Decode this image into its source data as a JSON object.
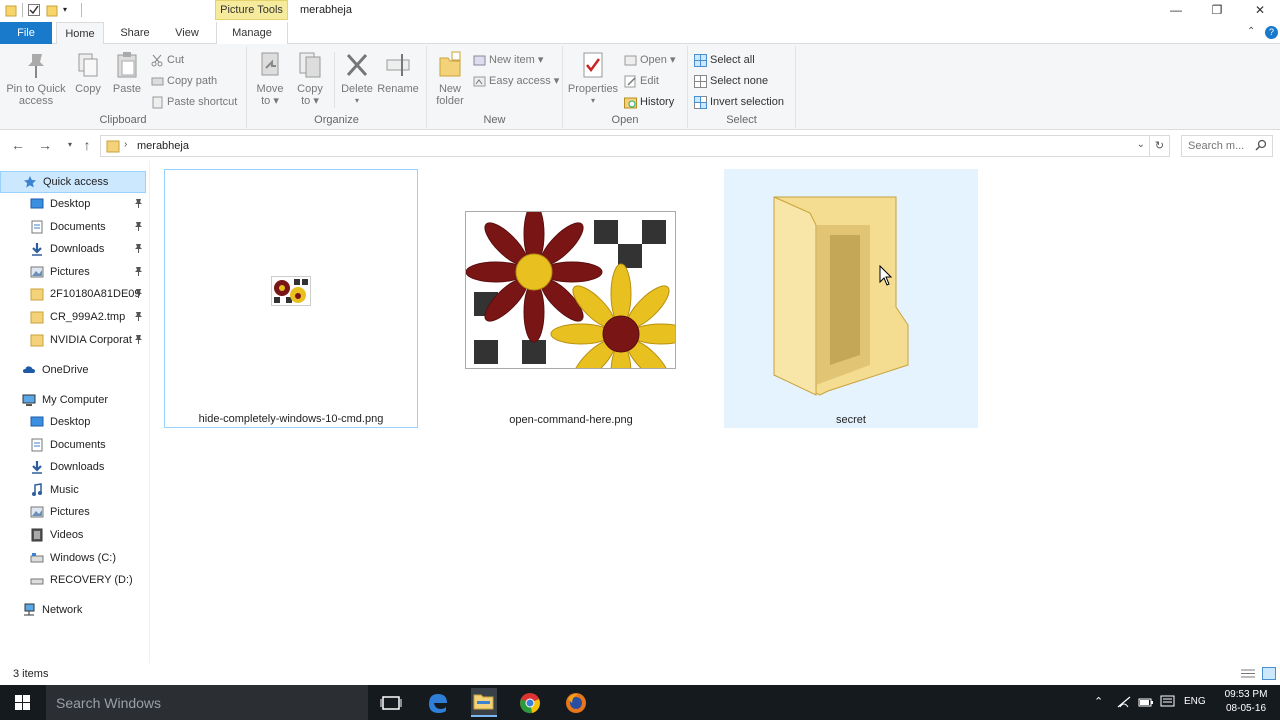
{
  "window": {
    "title": "merabheja",
    "context_tab": "Picture Tools",
    "controls": {
      "minimize": "—",
      "restore": "❐",
      "close": "✕"
    }
  },
  "tabs": {
    "file": "File",
    "home": "Home",
    "share": "Share",
    "view": "View",
    "manage": "Manage"
  },
  "ribbon": {
    "clipboard": {
      "label": "Clipboard",
      "pin_line1": "Pin to Quick",
      "pin_line2": "access",
      "copy": "Copy",
      "paste": "Paste",
      "cut": "Cut",
      "copy_path": "Copy path",
      "paste_shortcut": "Paste shortcut"
    },
    "organize": {
      "label": "Organize",
      "move_line1": "Move",
      "move_line2": "to ▾",
      "copyto_line1": "Copy",
      "copyto_line2": "to ▾",
      "delete": "Delete",
      "rename": "Rename"
    },
    "new": {
      "label": "New",
      "new_folder_line1": "New",
      "new_folder_line2": "folder",
      "new_item": "New item ▾",
      "easy_access": "Easy access ▾"
    },
    "open": {
      "label": "Open",
      "properties": "Properties",
      "open": "Open ▾",
      "edit": "Edit",
      "history": "History"
    },
    "select": {
      "label": "Select",
      "select_all": "Select all",
      "select_none": "Select none",
      "invert_selection": "Invert selection"
    }
  },
  "address": {
    "path": "merabheja",
    "search_placeholder": "Search m..."
  },
  "nav": {
    "quick_access": "Quick access",
    "qa_items": [
      "Desktop",
      "Documents",
      "Downloads",
      "Pictures",
      "2F10180A81DE09",
      "CR_999A2.tmp",
      "NVIDIA Corporat"
    ],
    "onedrive": "OneDrive",
    "my_computer": "My Computer",
    "pc_items": [
      "Desktop",
      "Documents",
      "Downloads",
      "Music",
      "Pictures",
      "Videos",
      "Windows (C:)",
      "RECOVERY (D:)"
    ],
    "network": "Network"
  },
  "files": [
    {
      "name": "hide-completely-windows-10-cmd.png",
      "kind": "image-thumbnail-small"
    },
    {
      "name": "open-command-here.png",
      "kind": "image-thumbnail-large"
    },
    {
      "name": "secret",
      "kind": "folder"
    }
  ],
  "status": {
    "item_count": "3 items"
  },
  "taskbar": {
    "search_placeholder": "Search Windows",
    "language": "ENG",
    "time": "09:53 PM",
    "date": "08-05-16"
  },
  "colors": {
    "accent": "#1979ca",
    "context_tab": "#f6eb9c",
    "selection": "#cce8ff",
    "taskbar": "#151a1f"
  }
}
